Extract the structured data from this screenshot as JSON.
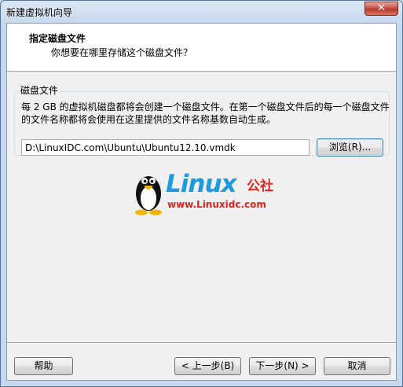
{
  "window": {
    "title": "新建虚拟机向导",
    "close_glyph": "✕"
  },
  "header": {
    "title": "指定磁盘文件",
    "subtitle": "你想要在哪里存储这个磁盘文件？"
  },
  "disk_file": {
    "group_label": "磁盘文件",
    "description": "每 2 GB 的虚拟机磁盘都将会创建一个磁盘文件。在第一个磁盘文件后的每一个磁盘文件的文件名称都将会使用在这里提供的文件名称基数自动生成。",
    "path_value": "D:\\LinuxIDC.com\\Ubuntu\\Ubuntu12.10.vmdk",
    "browse_label": "浏览(R)..."
  },
  "watermark": {
    "word": "Linux",
    "cn": "公社",
    "url": "www.Linuxidc.com"
  },
  "footer": {
    "help": "帮助",
    "back": "< 上一步(B)",
    "next": "下一步(N) >",
    "cancel": "取消"
  },
  "colors": {
    "titlebar": "#c6d8ee",
    "logo_blue": "#1f9ae0",
    "logo_red": "#e4231f",
    "close_red": "#c75050"
  }
}
